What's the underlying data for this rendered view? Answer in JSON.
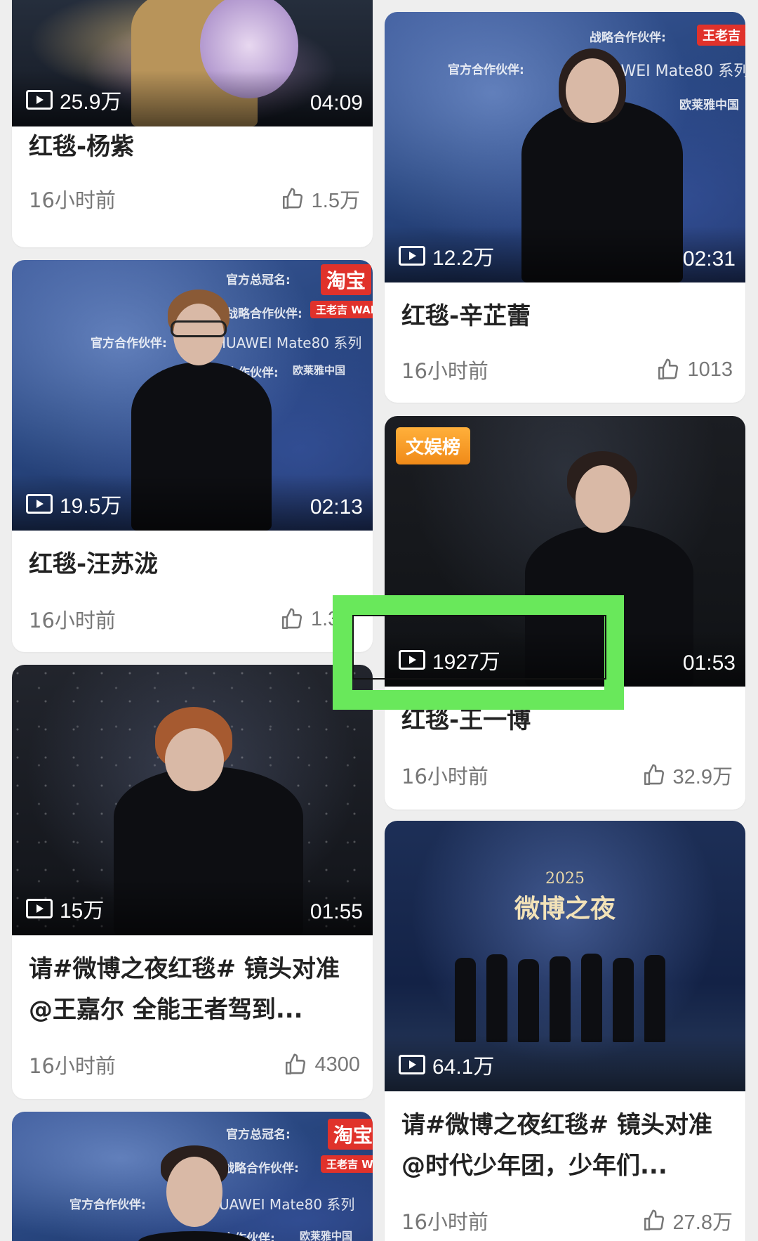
{
  "feed": {
    "cards": [
      {
        "title": "红毯-杨紫",
        "play_count": "25.9万",
        "duration": "04:09",
        "time": "16小时前",
        "likes": "1.5万"
      },
      {
        "title": "红毯-辛芷蕾",
        "play_count": "12.2万",
        "duration": "02:31",
        "time": "16小时前",
        "likes": "1013"
      },
      {
        "title": "红毯-汪苏泷",
        "play_count": "19.5万",
        "duration": "02:13",
        "time": "16小时前",
        "likes": "1.3"
      },
      {
        "title": "红毯-王一博",
        "play_count": "1927万",
        "duration": "01:53",
        "time": "16小时前",
        "likes": "32.9万",
        "badge": "文娱榜"
      },
      {
        "title": "请#微博之夜红毯# 镜头对准@王嘉尔 全能王者驾到...",
        "play_count": "15万",
        "duration": "01:55",
        "time": "16小时前",
        "likes": "4300"
      },
      {
        "title": "请#微博之夜红毯# 镜头对准@时代少年团，少年们...",
        "play_count": "64.1万",
        "duration": "",
        "time": "16小时前",
        "likes": "27.8万"
      },
      {
        "title": "",
        "play_count": "",
        "duration": "",
        "time": "",
        "likes": ""
      }
    ]
  },
  "sponsors": {
    "title_sponsor_label": "官方总冠名:",
    "title_sponsor_brand": "淘宝",
    "strategic_partner_label": "战略合作伙伴:",
    "strategic_partner_brand": "王老吉 WALO",
    "official_partner_label": "官方合作伙伴:",
    "official_partner_brand": "HUAWEI Mate80 系列",
    "partner_label": "合作伙伴:",
    "partner_brand": "欧莱雅中国"
  },
  "stage": {
    "logo_year": "2025",
    "logo_title": "微博之夜"
  },
  "colors": {
    "highlight": "#69e85b",
    "badge_orange": "#f59a22",
    "card_bg": "#ffffff",
    "page_bg": "#eeeeee"
  },
  "icons": {
    "play": "play-icon",
    "like": "thumbs-up-icon"
  }
}
